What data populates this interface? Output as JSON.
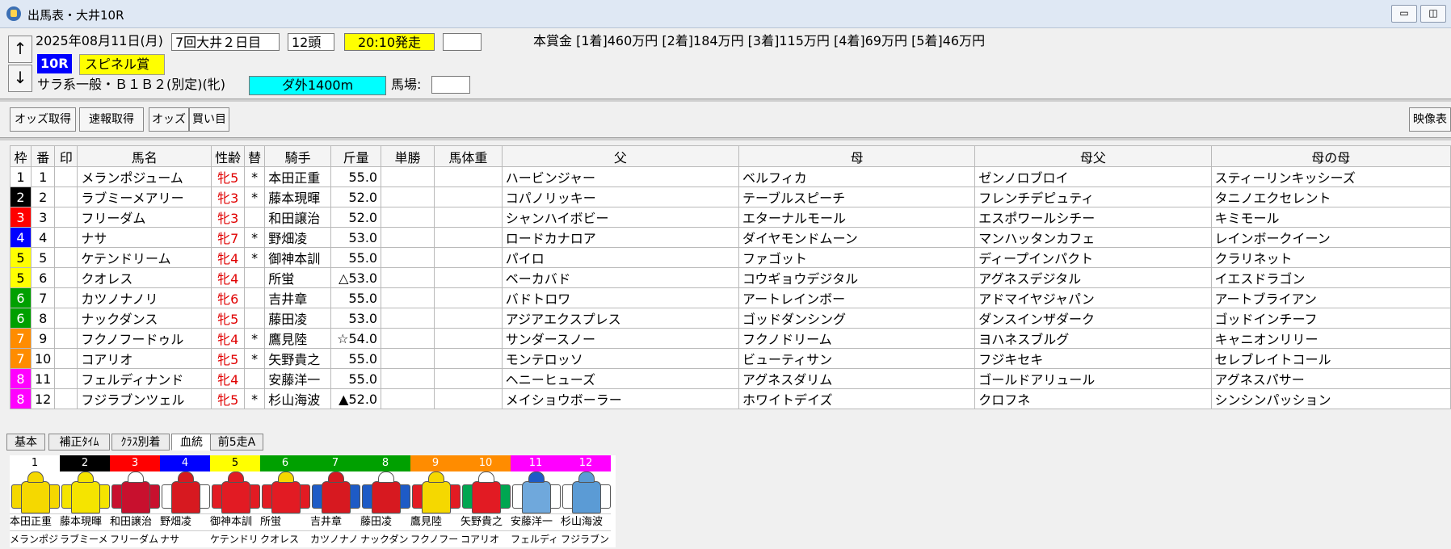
{
  "window": {
    "title": "出馬表・大井10R"
  },
  "info": {
    "date": "2025年08月11日(月)",
    "meeting": "7回大井２日目",
    "heads": "12頭",
    "post_time": "20:10発走",
    "extra_box": "",
    "prize": "本賞金 [1着]460万円 [2着]184万円 [3着]115万円 [4着]69万円 [5着]46万円",
    "race_no": "10R",
    "race_name": "スピネル賞",
    "conditions": "サラ系一般・Ｂ１Ｂ２(別定)(牝)",
    "course": "ダ外1400m",
    "baba_label": "馬場:",
    "baba_value": "",
    "up_arrow": "↑",
    "down_arrow": "↓"
  },
  "toolbar": {
    "odds_get": "オッズ取得",
    "renpuku_get": "速報取得",
    "odds": "オッズ",
    "kaime": "買い目",
    "video": "映像表"
  },
  "table": {
    "headers": [
      "枠",
      "番",
      "印",
      "馬名",
      "性齢",
      "替",
      "騎手",
      "斤量",
      "単勝",
      "馬体重",
      "父",
      "母",
      "母父",
      "母の母"
    ],
    "rows": [
      {
        "waku": "1",
        "ban": "1",
        "mark": "",
        "name": "メランポジューム",
        "sexage": "牝5",
        "kae": "*",
        "jockey": "本田正重",
        "kinryo": "55.0",
        "tansho": "",
        "weight": "",
        "father": "ハービンジャー",
        "mother": "ベルフィカ",
        "bmsire": "ゼンノロブロイ",
        "mm": "スティーリンキッシーズ"
      },
      {
        "waku": "2",
        "ban": "2",
        "mark": "",
        "name": "ラブミーメアリー",
        "sexage": "牝3",
        "kae": "*",
        "jockey": "藤本現暉",
        "kinryo": "52.0",
        "tansho": "",
        "weight": "",
        "father": "コパノリッキー",
        "mother": "テーブルスピーチ",
        "bmsire": "フレンチデピュティ",
        "mm": "タニノエクセレント"
      },
      {
        "waku": "3",
        "ban": "3",
        "mark": "",
        "name": "フリーダム",
        "sexage": "牝3",
        "kae": "",
        "jockey": "和田譲治",
        "kinryo": "52.0",
        "tansho": "",
        "weight": "",
        "father": "シャンハイボビー",
        "mother": "エターナルモール",
        "bmsire": "エスポワールシチー",
        "mm": "キミモール"
      },
      {
        "waku": "4",
        "ban": "4",
        "mark": "",
        "name": "ナサ",
        "sexage": "牝7",
        "kae": "*",
        "jockey": "野畑凌",
        "kinryo": "53.0",
        "tansho": "",
        "weight": "",
        "father": "ロードカナロア",
        "mother": "ダイヤモンドムーン",
        "bmsire": "マンハッタンカフェ",
        "mm": "レインボークイーン"
      },
      {
        "waku": "5",
        "ban": "5",
        "mark": "",
        "name": "ケテンドリーム",
        "sexage": "牝4",
        "kae": "*",
        "jockey": "御神本訓",
        "kinryo": "55.0",
        "tansho": "",
        "weight": "",
        "father": "パイロ",
        "mother": "ファゴット",
        "bmsire": "ディープインパクト",
        "mm": "クラリネット"
      },
      {
        "waku": "5",
        "ban": "6",
        "mark": "",
        "name": "クオレス",
        "sexage": "牝4",
        "kae": "",
        "jockey": "所蛍",
        "kinryo": "△53.0",
        "tansho": "",
        "weight": "",
        "father": "ベーカバド",
        "mother": "コウギョウデジタル",
        "bmsire": "アグネスデジタル",
        "mm": "イエスドラゴン"
      },
      {
        "waku": "6",
        "ban": "7",
        "mark": "",
        "name": "カツノナノリ",
        "sexage": "牝6",
        "kae": "",
        "jockey": "吉井章",
        "kinryo": "55.0",
        "tansho": "",
        "weight": "",
        "father": "バドトロワ",
        "mother": "アートレインボー",
        "bmsire": "アドマイヤジャパン",
        "mm": "アートブライアン"
      },
      {
        "waku": "6",
        "ban": "8",
        "mark": "",
        "name": "ナックダンス",
        "sexage": "牝5",
        "kae": "",
        "jockey": "藤田凌",
        "kinryo": "53.0",
        "tansho": "",
        "weight": "",
        "father": "アジアエクスプレス",
        "mother": "ゴッドダンシング",
        "bmsire": "ダンスインザダーク",
        "mm": "ゴッドインチーフ"
      },
      {
        "waku": "7",
        "ban": "9",
        "mark": "",
        "name": "フクノフードゥル",
        "sexage": "牝4",
        "kae": "*",
        "jockey": "鷹見陸",
        "kinryo": "☆54.0",
        "tansho": "",
        "weight": "",
        "father": "サンダースノー",
        "mother": "フクノドリーム",
        "bmsire": "ヨハネスブルグ",
        "mm": "キャニオンリリー"
      },
      {
        "waku": "7",
        "ban": "10",
        "mark": "",
        "name": "コアリオ",
        "sexage": "牝5",
        "kae": "*",
        "jockey": "矢野貴之",
        "kinryo": "55.0",
        "tansho": "",
        "weight": "",
        "father": "モンテロッソ",
        "mother": "ビューティサン",
        "bmsire": "フジキセキ",
        "mm": "セレブレイトコール"
      },
      {
        "waku": "8",
        "ban": "11",
        "mark": "",
        "name": "フェルディナンド",
        "sexage": "牝4",
        "kae": "",
        "jockey": "安藤洋一",
        "kinryo": "55.0",
        "tansho": "",
        "weight": "",
        "father": "ヘニーヒューズ",
        "mother": "アグネスダリム",
        "bmsire": "ゴールドアリュール",
        "mm": "アグネスパサー"
      },
      {
        "waku": "8",
        "ban": "12",
        "mark": "",
        "name": "フジラブンツェル",
        "sexage": "牝5",
        "kae": "*",
        "jockey": "杉山海波",
        "kinryo": "▲52.0",
        "tansho": "",
        "weight": "",
        "father": "メイショウボーラー",
        "mother": "ホワイトデイズ",
        "bmsire": "クロフネ",
        "mm": "シンシンパッション"
      }
    ]
  },
  "waku_colors": {
    "1": {
      "bg": "#ffffff",
      "fg": "#000000"
    },
    "2": {
      "bg": "#000000",
      "fg": "#ffffff"
    },
    "3": {
      "bg": "#ff0000",
      "fg": "#ffffff"
    },
    "4": {
      "bg": "#0000ff",
      "fg": "#ffffff"
    },
    "5": {
      "bg": "#ffff00",
      "fg": "#000000"
    },
    "6": {
      "bg": "#00a000",
      "fg": "#ffffff"
    },
    "7": {
      "bg": "#ff8c00",
      "fg": "#ffffff"
    },
    "8": {
      "bg": "#ff00ff",
      "fg": "#ffffff"
    }
  },
  "tabs": [
    "基本",
    "補正ﾀｲﾑ",
    "ｸﾗｽ別着",
    "血統",
    "前5走A"
  ],
  "silks": [
    {
      "num": "1",
      "jockey": "本田正重",
      "horse": "メランポジ",
      "body": "#f5d800",
      "arm": "#f5d800",
      "cap": "#f5d800",
      "waku": "1"
    },
    {
      "num": "2",
      "jockey": "藤本現暉",
      "horse": "ラブミーメ",
      "body": "#f5e400",
      "arm": "#f5e400",
      "cap": "#f5e400",
      "waku": "2"
    },
    {
      "num": "3",
      "jockey": "和田譲治",
      "horse": "フリーダム",
      "body": "#c8102e",
      "arm": "#c8102e",
      "cap": "#ffffff",
      "waku": "3"
    },
    {
      "num": "4",
      "jockey": "野畑凌",
      "horse": "ナサ",
      "body": "#d71920",
      "arm": "#ffffff",
      "cap": "#d71920",
      "waku": "4"
    },
    {
      "num": "5",
      "jockey": "御神本訓",
      "horse": "ケテンドリ",
      "body": "#e21b23",
      "arm": "#e21b23",
      "cap": "#e21b23",
      "waku": "5"
    },
    {
      "num": "6",
      "jockey": "所蛍",
      "horse": "クオレス",
      "body": "#e21b23",
      "arm": "#e21b23",
      "cap": "#f5d800",
      "waku": "6"
    },
    {
      "num": "7",
      "jockey": "吉井章",
      "horse": "カツノナノ",
      "body": "#d71920",
      "arm": "#1e5bc6",
      "cap": "#d71920",
      "waku": "6"
    },
    {
      "num": "8",
      "jockey": "藤田凌",
      "horse": "ナックダン",
      "body": "#d71920",
      "arm": "#1e5bc6",
      "cap": "#ffffff",
      "waku": "6"
    },
    {
      "num": "9",
      "jockey": "鷹見陸",
      "horse": "フクノフー",
      "body": "#f5d800",
      "arm": "#e21b23",
      "cap": "#f5d800",
      "waku": "7"
    },
    {
      "num": "10",
      "jockey": "矢野貴之",
      "horse": "コアリオ",
      "body": "#e21b23",
      "arm": "#00a651",
      "cap": "#ffffff",
      "waku": "7"
    },
    {
      "num": "11",
      "jockey": "安藤洋一",
      "horse": "フェルディ",
      "body": "#6fa8dc",
      "arm": "#ffffff",
      "cap": "#1e5bc6",
      "waku": "8"
    },
    {
      "num": "12",
      "jockey": "杉山海波",
      "horse": "フジラブン",
      "body": "#5b9bd5",
      "arm": "#ffffff",
      "cap": "#5b9bd5",
      "waku": "8"
    }
  ]
}
